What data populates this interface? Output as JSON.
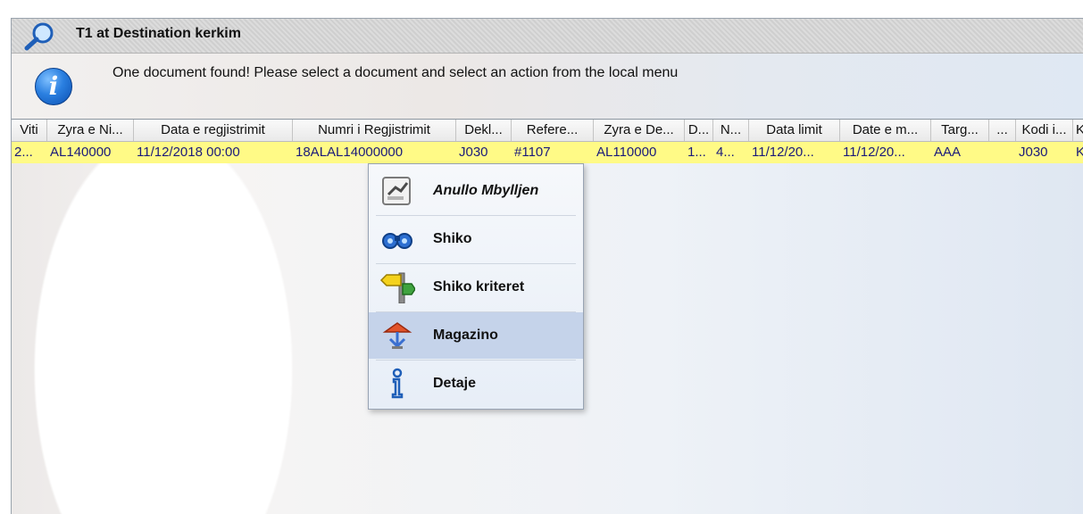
{
  "window": {
    "title": "T1 at Destination kerkim"
  },
  "info": {
    "message": "One document found! Please select a document and select an action from the local menu",
    "icon": "info-icon"
  },
  "table": {
    "columns": [
      "Viti",
      "Zyra e Ni...",
      "Data e regjistrimit",
      "Numri i Regjistrimit",
      "Dekl...",
      "Refere...",
      "Zyra e De...",
      "D...",
      "N...",
      "Data limit",
      "Date e m...",
      "Targ...",
      "...",
      "Kodi i...",
      "K"
    ],
    "rows": [
      [
        "2...",
        "AL140000",
        "11/12/2018 00:00",
        "18ALAL14000000",
        "J030",
        "#1107",
        "AL110000",
        "1...",
        "4...",
        "11/12/20...",
        "11/12/20...",
        "AAA",
        "",
        "J030",
        "K"
      ]
    ],
    "selected_row_color": "#fffa86"
  },
  "context_menu": {
    "items": [
      {
        "label": "Anullo Mbylljen",
        "icon": "cancel-close-icon",
        "italic": true
      },
      {
        "label": "Shiko",
        "icon": "binoculars-icon"
      },
      {
        "label": "Shiko kriteret",
        "icon": "signpost-icon"
      },
      {
        "label": "Magazino",
        "icon": "warehouse-icon",
        "highlighted": true
      },
      {
        "label": "Detaje",
        "icon": "info-detail-icon"
      }
    ]
  }
}
